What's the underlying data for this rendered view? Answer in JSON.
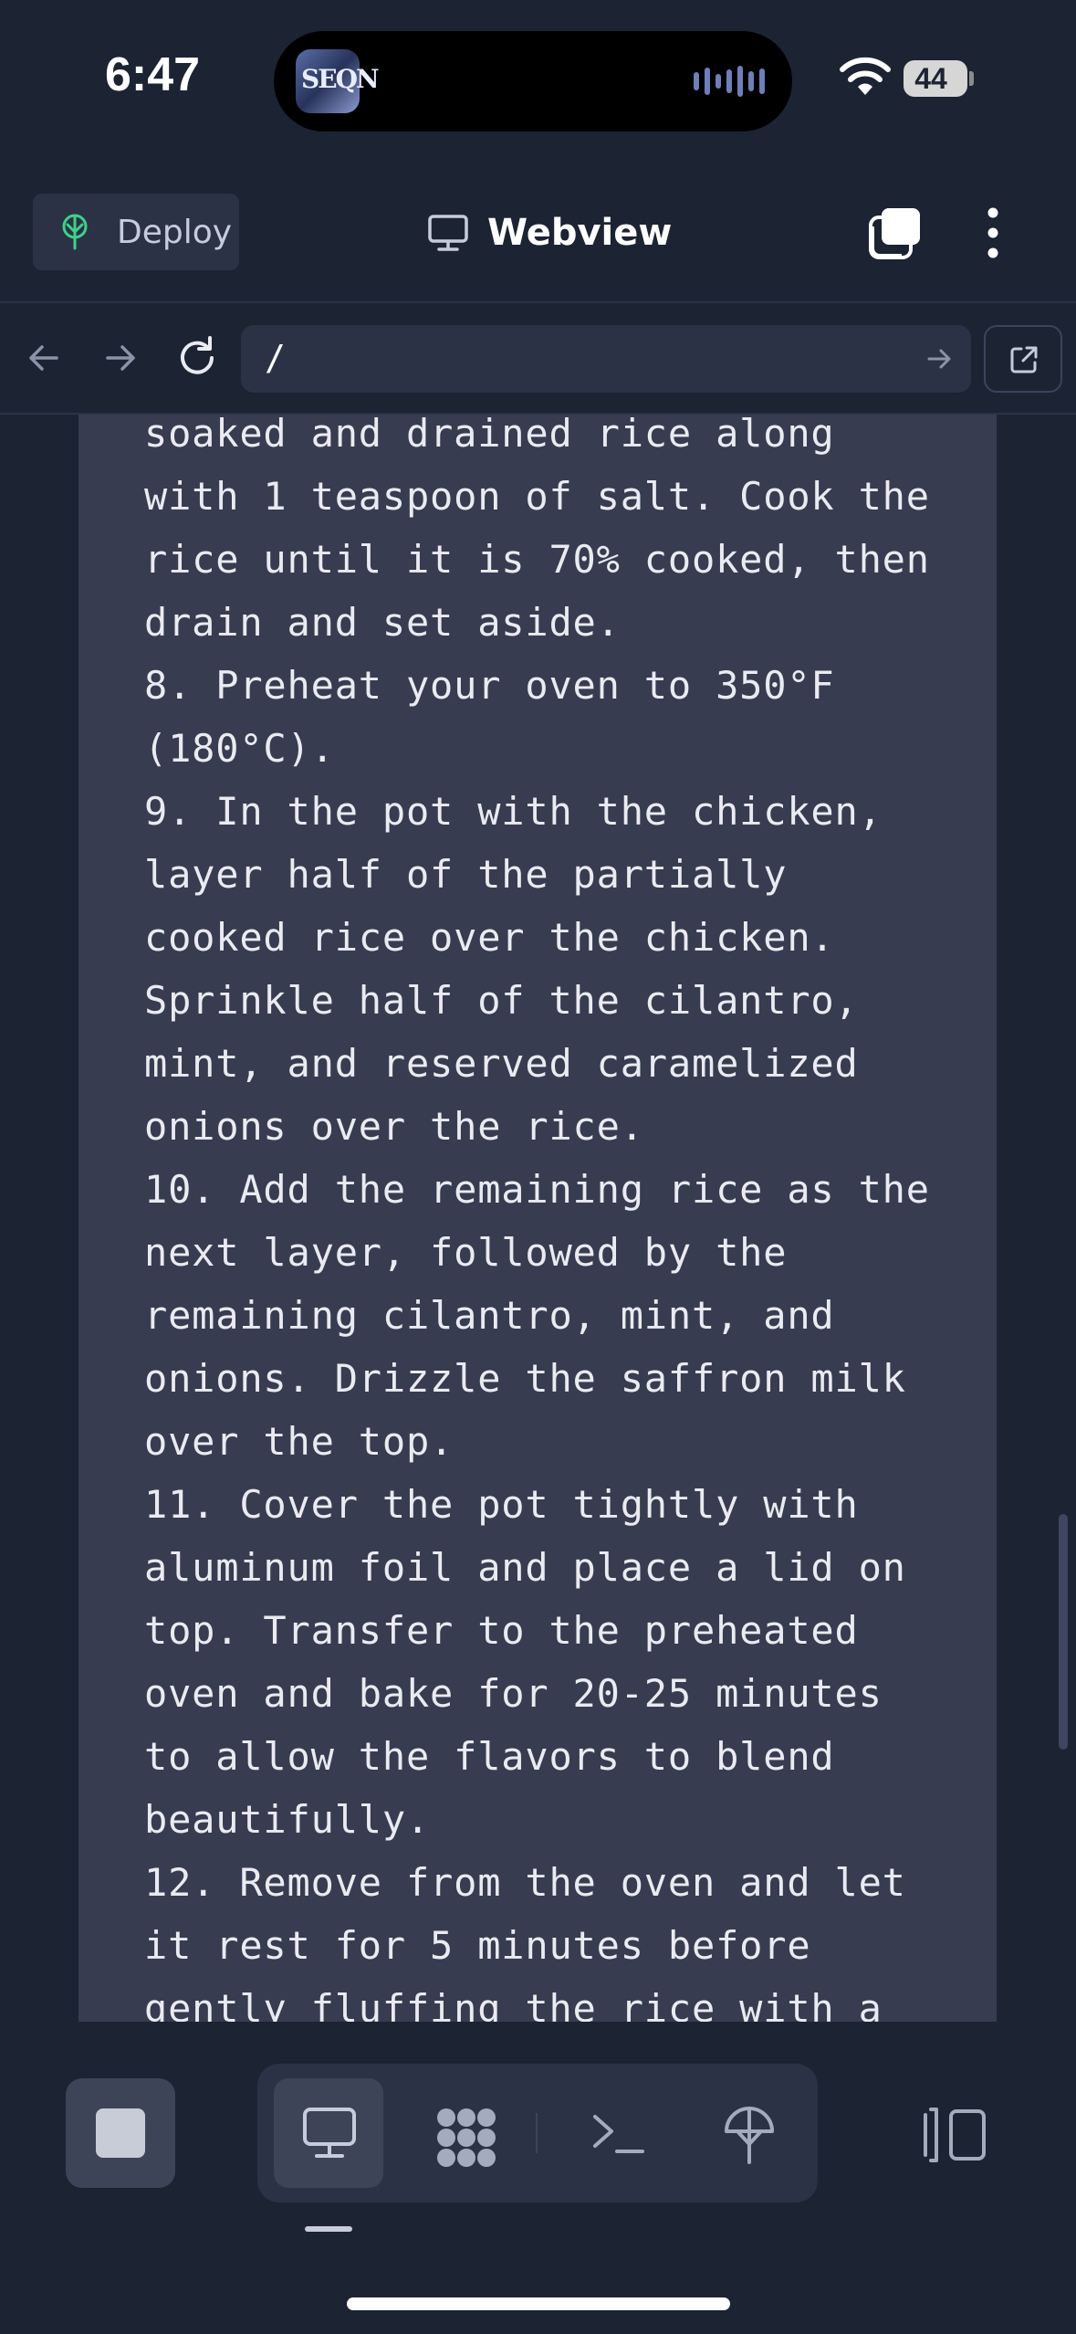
{
  "status_bar": {
    "time": "6:47",
    "battery": "44",
    "island_app_label": "SEQN"
  },
  "header": {
    "deploy_label": "Deploy",
    "title": "Webview"
  },
  "url_bar": {
    "path": "/"
  },
  "content": {
    "lines": [
      "soaked and drained rice along",
      "with 1 teaspoon of salt. Cook the",
      "rice until it is 70% cooked, then",
      "drain and set aside.",
      "8. Preheat your oven to 350°F",
      "(180°C).",
      "9. In the pot with the chicken,",
      "layer half of the partially",
      "cooked rice over the chicken.",
      "Sprinkle half of the cilantro,",
      "mint, and reserved caramelized",
      "onions over the rice.",
      "10. Add the remaining rice as the",
      "next layer, followed by the",
      "remaining cilantro, mint, and",
      "onions. Drizzle the saffron milk",
      "over the top.",
      "11. Cover the pot tightly with",
      "aluminum foil and place a lid on",
      "top. Transfer to the preheated",
      "oven and bake for 20-25 minutes",
      "to allow the flavors to blend",
      "beautifully.",
      "12. Remove from the oven and let",
      "it rest for 5 minutes before",
      "gently fluffing the rice with a"
    ]
  },
  "icons": {
    "deploy": "deploy-tree-icon",
    "webview": "monitor-icon",
    "tabs": "tabs-icon",
    "more": "more-vertical-icon",
    "back": "arrow-left-icon",
    "forward": "arrow-right-icon",
    "reload": "reload-icon",
    "go": "arrow-right-icon",
    "open_external": "external-link-icon",
    "stop": "stop-icon",
    "webview_tool": "monitor-icon",
    "packager": "packages-icon",
    "shell": "terminal-icon",
    "deploy_tool": "deploy-tree-icon",
    "panels": "panel-toggle-icon"
  },
  "colors": {
    "background": "#1c2333",
    "surface": "#2b3245",
    "card": "#383c50",
    "deploy_accent": "#3fd08a",
    "text": "#e9ebf1"
  }
}
